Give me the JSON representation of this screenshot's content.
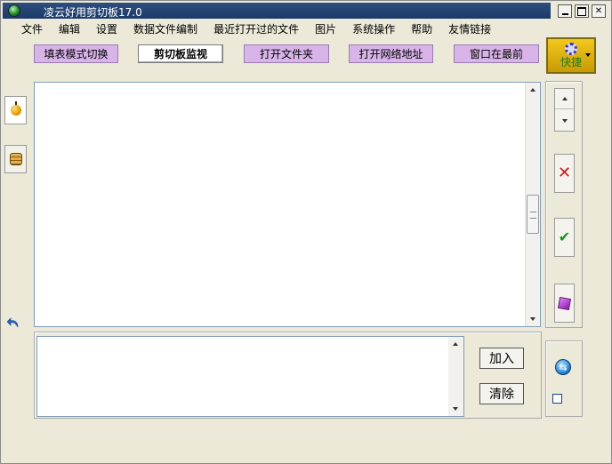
{
  "window": {
    "title": "凌云好用剪切板17.0"
  },
  "menu": [
    "文件",
    "编辑",
    "设置",
    "数据文件编制",
    "最近打开过的文件",
    "图片",
    "系统操作",
    "帮助",
    "友情链接"
  ],
  "toolbar": {
    "fill_mode": "填表模式切换",
    "clipboard_monitor": "剪切板监视",
    "open_folder": "打开文件夹",
    "open_url": "打开网络地址",
    "topmost": "窗口在最前",
    "quick": "快捷"
  },
  "main_text": "",
  "input": {
    "value": "",
    "add_label": "加入",
    "clear_label": "清除"
  },
  "icons": {
    "app": "app-icon",
    "fruit": "fruit-icon",
    "stack": "stack-icon",
    "undo": "undo-icon",
    "delete": "close-x-icon",
    "confirm": "checkmark-icon",
    "gift": "gift-icon",
    "refresh": "refresh-icon"
  },
  "colors": {
    "toolbar_button": "#d8b4e8",
    "quick_button": "#f2c81e",
    "titlebar": "#2e4e7e",
    "delete_icon": "#d01818",
    "confirm_icon": "#17901e"
  }
}
